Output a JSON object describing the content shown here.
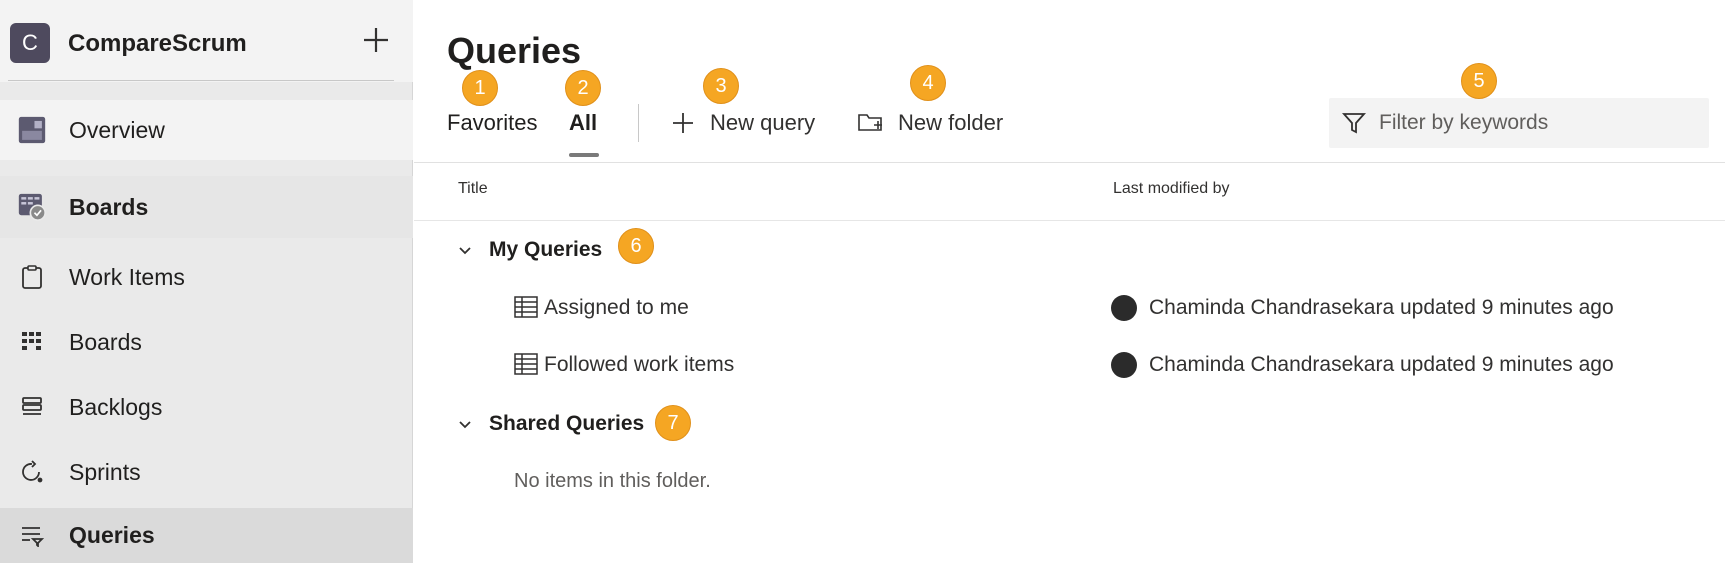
{
  "project": {
    "initial": "C",
    "name": "CompareScrum"
  },
  "sidebar": {
    "overview": "Overview",
    "boards_hub": "Boards",
    "items": {
      "work_items": "Work Items",
      "boards": "Boards",
      "backlogs": "Backlogs",
      "sprints": "Sprints",
      "queries": "Queries"
    }
  },
  "main": {
    "title": "Queries",
    "tabs": {
      "favorites": "Favorites",
      "all": "All"
    },
    "commands": {
      "new_query": "New query",
      "new_folder": "New folder"
    },
    "filter": {
      "placeholder": "Filter by keywords"
    },
    "columns": {
      "title": "Title",
      "last_modified": "Last modified by"
    },
    "folders": {
      "my_queries": {
        "label": "My Queries",
        "rows": [
          {
            "title": "Assigned to me",
            "modified": "Chaminda Chandrasekara updated 9 minutes ago"
          },
          {
            "title": "Followed work items",
            "modified": "Chaminda Chandrasekara updated 9 minutes ago"
          }
        ]
      },
      "shared_queries": {
        "label": "Shared Queries",
        "empty": "No items in this folder."
      }
    }
  },
  "callouts": [
    "1",
    "2",
    "3",
    "4",
    "5",
    "6",
    "7"
  ],
  "colors": {
    "callout": "#f5a623",
    "sidebar_bg": "#eaeaea",
    "selected_bg": "#dadada",
    "avatar_bg": "#4e4a5e"
  }
}
